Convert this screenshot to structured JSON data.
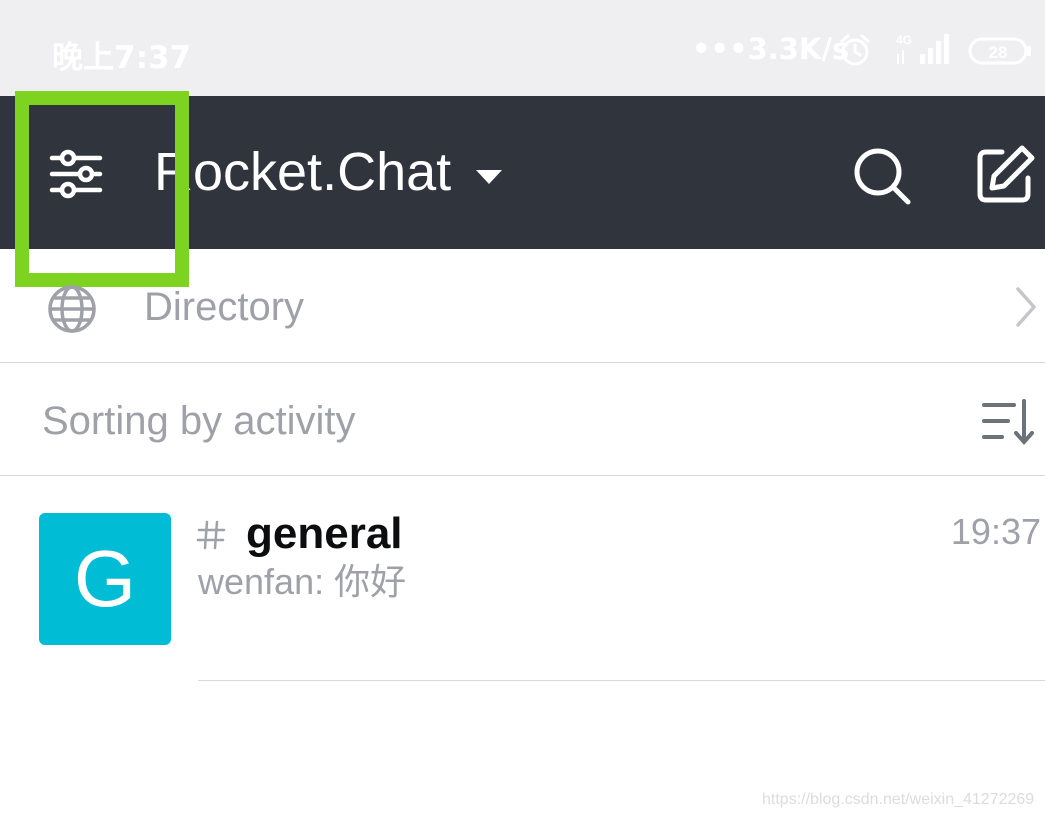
{
  "status_bar": {
    "time": "晚上7:37",
    "network_speed": "•••3.3K/s",
    "network_type": "4G",
    "battery_level": "28",
    "icons": [
      "alarm-icon",
      "signal-icon",
      "battery-icon"
    ]
  },
  "header": {
    "title": "Rocket.Chat",
    "icons": {
      "settings": "sliders-icon",
      "dropdown": "caret-down-icon",
      "search": "search-icon",
      "compose": "compose-icon"
    },
    "background_color": "#30343d"
  },
  "highlight": {
    "color": "#7ed321",
    "target": "settings-button"
  },
  "directory": {
    "label": "Directory",
    "icon": "globe-icon",
    "trailing_icon": "chevron-right-icon"
  },
  "sorting": {
    "label": "Sorting by activity",
    "icon": "sort-icon"
  },
  "rooms": [
    {
      "avatar_letter": "G",
      "avatar_color": "#01bcd5",
      "type_icon": "hash-icon",
      "name": "general",
      "time": "19:37",
      "last_message": "wenfan: 你好"
    }
  ],
  "watermark": "https://blog.csdn.net/weixin_41272269"
}
